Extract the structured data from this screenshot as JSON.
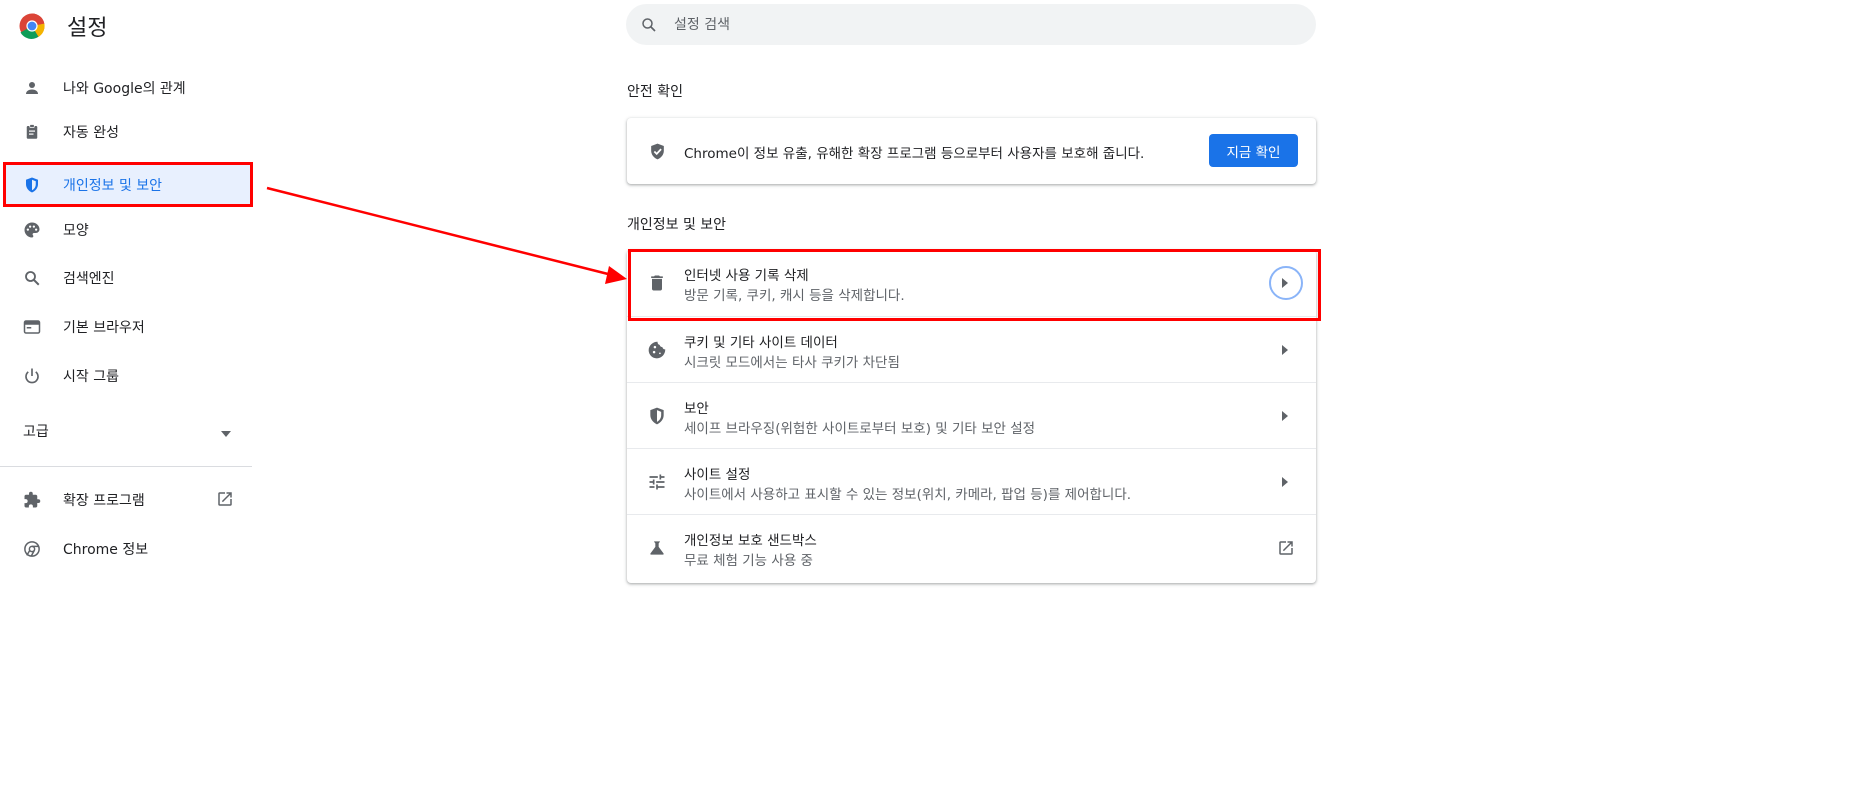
{
  "header": {
    "title": "설정",
    "search_placeholder": "설정 검색"
  },
  "sidebar": {
    "items": [
      {
        "label": "나와 Google의 관계",
        "icon": "person-icon"
      },
      {
        "label": "자동 완성",
        "icon": "clipboard-icon"
      },
      {
        "label": "개인정보 및 보안",
        "icon": "shield-icon",
        "active": true
      },
      {
        "label": "모양",
        "icon": "palette-icon"
      },
      {
        "label": "검색엔진",
        "icon": "search-icon"
      },
      {
        "label": "기본 브라우저",
        "icon": "browser-window-icon"
      },
      {
        "label": "시작 그룹",
        "icon": "power-icon"
      }
    ],
    "advanced_label": "고급",
    "extensions_label": "확장 프로그램",
    "about_label": "Chrome 정보"
  },
  "safety_check": {
    "section_title": "안전 확인",
    "description": "Chrome이 정보 유출, 유해한 확장 프로그램 등으로부터 사용자를 보호해 줍니다.",
    "button_label": "지금 확인"
  },
  "privacy": {
    "section_title": "개인정보 및 보안",
    "rows": [
      {
        "title": "인터넷 사용 기록 삭제",
        "subtitle": "방문 기록, 쿠키, 캐시 등을 삭제합니다.",
        "icon": "trash-icon"
      },
      {
        "title": "쿠키 및 기타 사이트 데이터",
        "subtitle": "시크릿 모드에서는 타사 쿠키가 차단됨",
        "icon": "cookie-icon"
      },
      {
        "title": "보안",
        "subtitle": "세이프 브라우징(위험한 사이트로부터 보호) 및 기타 보안 설정",
        "icon": "shield-icon"
      },
      {
        "title": "사이트 설정",
        "subtitle": "사이트에서 사용하고 표시할 수 있는 정보(위치, 카메라, 팝업 등)를 제어합니다.",
        "icon": "tune-icon"
      },
      {
        "title": "개인정보 보호 샌드박스",
        "subtitle": "무료 체험 기능 사용 중",
        "icon": "flask-icon"
      }
    ]
  },
  "colors": {
    "accent": "#1a73e8",
    "annotation": "#ff0000",
    "active_bg": "#e8f0fe"
  }
}
